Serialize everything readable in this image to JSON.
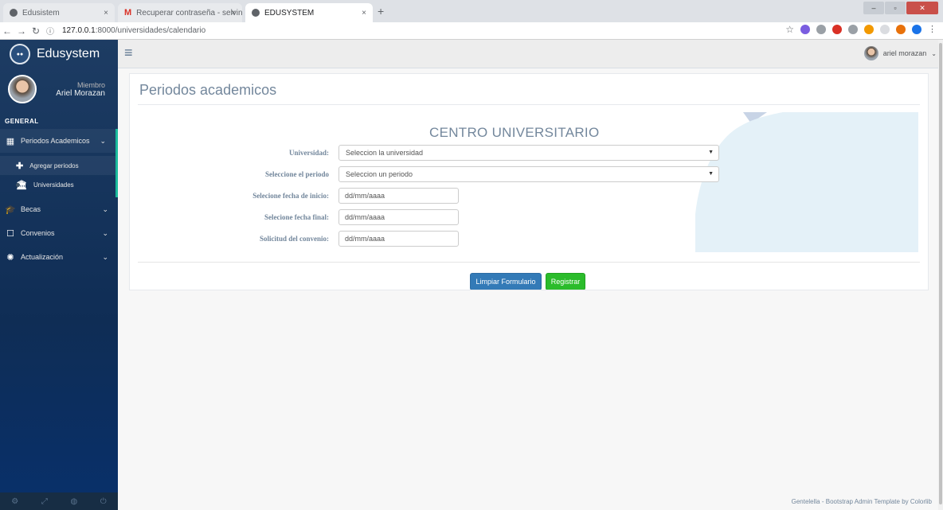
{
  "browser": {
    "tabs": [
      {
        "title": "Edusistem"
      },
      {
        "title": "Recuperar contraseña - selvinm"
      },
      {
        "title": "EDUSYSTEM"
      }
    ],
    "url_host": "127.0.0.1",
    "url_path": ":8000/universidades/calendario"
  },
  "sidebar": {
    "brand": "Edusystem",
    "profile_role": "Miembro",
    "profile_name": "Ariel Morazan",
    "section": "GENERAL",
    "menu": {
      "periodos": "Periodos Academicos",
      "agregar": "Agregar periodos",
      "universidades": "Universidades",
      "becas": "Becas",
      "convenios": "Convenios",
      "actualizacion": "Actualización"
    }
  },
  "topnav": {
    "user": "ariel morazan"
  },
  "panel": {
    "title": "Periodos academicos",
    "heading": "CENTRO UNIVERSITARIO",
    "fields": {
      "universidad_label": "Universidad:",
      "universidad_value": "Seleccion la universidad",
      "periodo_label": "Seleccione el periodo",
      "periodo_value": "Seleccion un periodo",
      "inicio_label": "Selecione fecha de inicio:",
      "inicio_value": "dd/mm/aaaa",
      "final_label": "Selecione fecha final:",
      "final_value": "dd/mm/aaaa",
      "convenio_label": "Solicitud del convenio:",
      "convenio_value": "dd/mm/aaaa"
    },
    "buttons": {
      "clear": "Limpiar Formulario",
      "save": "Registrar"
    }
  },
  "footer": "Gentelella - Bootstrap Admin Template by Colorlib",
  "colors": {
    "sidebar": "#0f2d55",
    "accent": "#1abb9c",
    "primary": "#337ab7",
    "success": "#2bbc2b"
  }
}
